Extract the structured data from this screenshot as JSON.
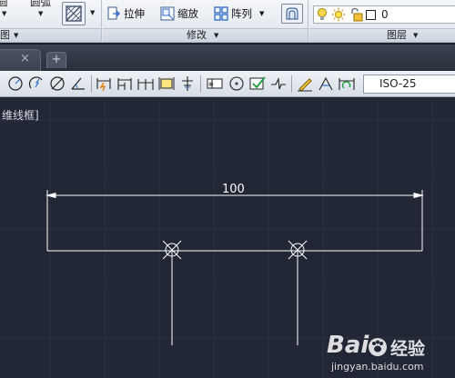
{
  "ribbon": {
    "draw_panel": {
      "arc_label": "圆弧",
      "title": "图"
    },
    "modify_panel": {
      "stretch_label": "拉伸",
      "scale_label": "缩放",
      "array_label": "阵列",
      "title": "修改"
    },
    "layers_panel": {
      "layer_name": "0",
      "title": "图层"
    }
  },
  "tabs": {
    "close_glyph": "×",
    "new_tab_glyph": "+"
  },
  "dim_toolbar": {
    "dim_style": "ISO-25"
  },
  "canvas": {
    "viewport_label": "维线框]",
    "dimension_value": "100",
    "colors": {
      "background": "#212734",
      "grid": "#2c3342",
      "lines": "#ffffff"
    }
  },
  "watermark": {
    "brand": "Bai",
    "brand_suffix": "经验",
    "url": "jingyan.baidu.com"
  }
}
